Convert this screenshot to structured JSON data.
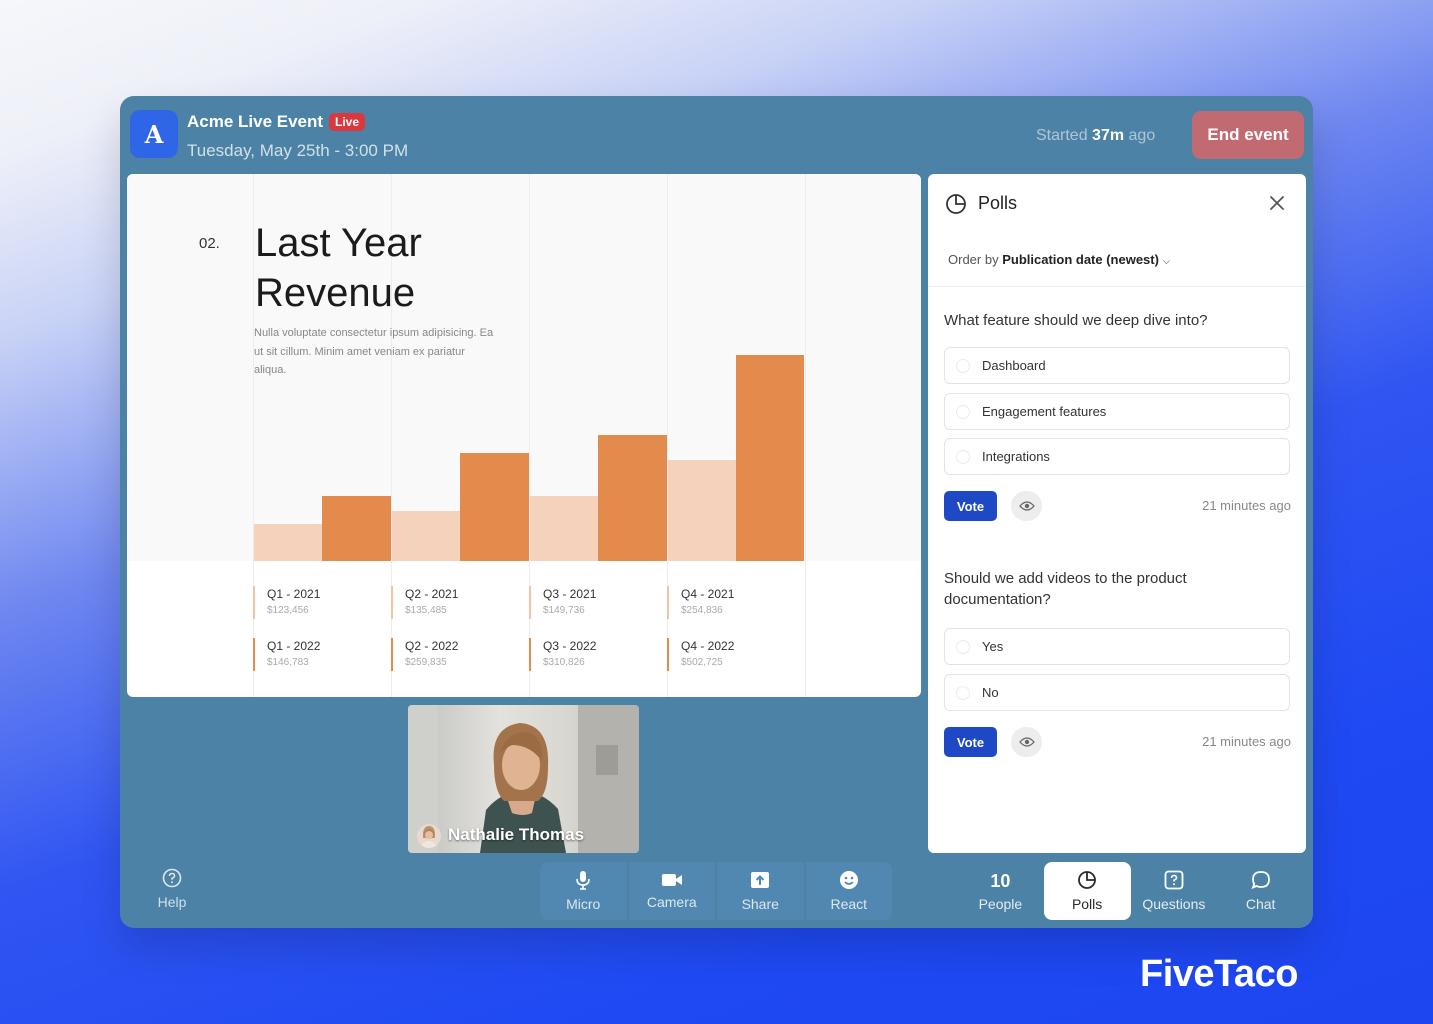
{
  "header": {
    "logo_letter": "A",
    "event_title": "Acme Live Event",
    "live_badge": "Live",
    "event_date": "Tuesday, May 25th - 3:00 PM",
    "started_prefix": "Started",
    "started_duration": "37m",
    "started_suffix": "ago",
    "end_event_label": "End event"
  },
  "slide": {
    "number": "02.",
    "title": "Last Year Revenue",
    "description": "Nulla voluptate consectetur ipsum adipisicing. Ea ut sit cillum. Minim amet veniam ex pariatur aliqua.",
    "revenue_2021": [
      {
        "label": "Q1 - 2021",
        "value": "$123,456"
      },
      {
        "label": "Q2 - 2021",
        "value": "$135,485"
      },
      {
        "label": "Q3 - 2021",
        "value": "$149,736"
      },
      {
        "label": "Q4 - 2021",
        "value": "$254,836"
      }
    ],
    "revenue_2022": [
      {
        "label": "Q1 - 2022",
        "value": "$146,783"
      },
      {
        "label": "Q2 - 2022",
        "value": "$259,835"
      },
      {
        "label": "Q3 - 2022",
        "value": "$310,826"
      },
      {
        "label": "Q4 - 2022",
        "value": "$502,725"
      }
    ],
    "colors": {
      "series_2021": "#f5d2bb",
      "series_2022": "#e38a4d"
    }
  },
  "video": {
    "participant_name": "Nathalie Thomas"
  },
  "polls": {
    "title": "Polls",
    "order_prefix": "Order by",
    "order_value": "Publication date (newest)",
    "items": [
      {
        "question": "What feature should we deep dive into?",
        "options": [
          "Dashboard",
          "Engagement features",
          "Integrations"
        ],
        "vote_label": "Vote",
        "time": "21 minutes ago"
      },
      {
        "question": "Should we add videos to the product documentation?",
        "options": [
          "Yes",
          "No"
        ],
        "vote_label": "Vote",
        "time": "21 minutes ago"
      }
    ]
  },
  "bottom_bar": {
    "help_label": "Help",
    "controls": [
      {
        "label": "Micro",
        "icon": "microphone-icon"
      },
      {
        "label": "Camera",
        "icon": "camera-icon"
      },
      {
        "label": "Share",
        "icon": "share-icon"
      },
      {
        "label": "React",
        "icon": "smiley-icon"
      }
    ],
    "tabs": [
      {
        "label": "People",
        "count": "10"
      },
      {
        "label": "Polls",
        "icon": "polls-icon",
        "active": true
      },
      {
        "label": "Questions",
        "icon": "questions-icon"
      },
      {
        "label": "Chat",
        "icon": "chat-icon"
      }
    ]
  },
  "brand": "FiveTaco"
}
